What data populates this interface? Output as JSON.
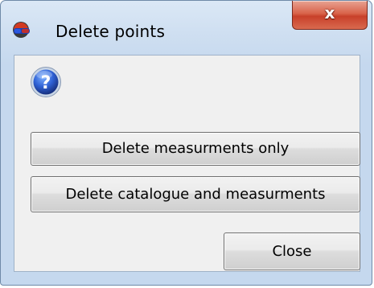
{
  "window": {
    "title": "Delete points",
    "close_glyph": "x",
    "app_icon": "glasses-icon",
    "accent_color": "#d9634a"
  },
  "dialog": {
    "icon": "question-icon",
    "buttons": {
      "delete_measurements_only": "Delete measurments only",
      "delete_catalogue_and_measurements": "Delete catalogue and measurments",
      "close": "Close"
    }
  }
}
